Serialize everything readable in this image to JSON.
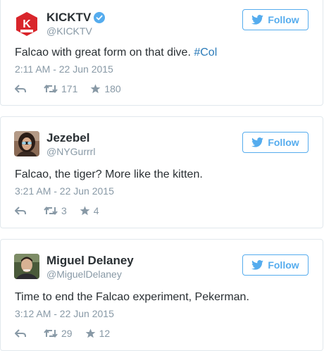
{
  "colors": {
    "twitter_blue": "#55acee",
    "link": "#2b7bb9",
    "text": "#292f33",
    "muted": "#8899a6",
    "border": "#e1e8ed",
    "kicktv_red": "#d9252b"
  },
  "tweets": [
    {
      "display_name": "KICKTV",
      "verified": true,
      "handle": "@KICKTV",
      "follow_label": "Follow",
      "text": "Falcao with great form on that dive. ",
      "hashtag": "#Col",
      "timestamp": "2:11 AM - 22 Jun 2015",
      "retweets": "171",
      "favorites": "180",
      "avatar_icon": "kicktv-logo-icon",
      "avatar_logo_text": "KICKTV"
    },
    {
      "display_name": "Jezebel",
      "verified": false,
      "handle": "@NYGurrrl",
      "follow_label": "Follow",
      "text": "Falcao, the tiger? More like the kitten.",
      "timestamp": "3:21 AM - 22 Jun 2015",
      "retweets": "3",
      "favorites": "4",
      "avatar_icon": "user-photo-icon"
    },
    {
      "display_name": "Miguel Delaney",
      "verified": false,
      "handle": "@MiguelDelaney",
      "follow_label": "Follow",
      "text": "Time to end the Falcao experiment, Pekerman.",
      "timestamp": "3:12 AM - 22 Jun 2015",
      "retweets": "29",
      "favorites": "12",
      "avatar_icon": "user-photo-icon"
    }
  ]
}
